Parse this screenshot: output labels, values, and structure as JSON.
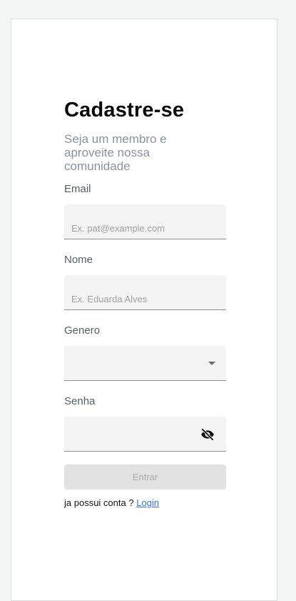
{
  "form": {
    "title": "Cadastre-se",
    "subtitle": "Seja um membro e aproveite nossa comunidade",
    "email": {
      "label": "Email",
      "placeholder": "Ex. pat@example.com",
      "value": ""
    },
    "nome": {
      "label": "Nome",
      "placeholder": "Ex. Eduarda Alves",
      "value": ""
    },
    "genero": {
      "label": "Genero",
      "selected": ""
    },
    "senha": {
      "label": "Senha",
      "value": ""
    },
    "submit_label": "Entrar",
    "footer_text": "ja possui conta ? ",
    "login_link": "Login"
  },
  "icons": {
    "dropdown": "chevron-down-icon",
    "password_visibility": "eye-off-icon"
  },
  "colors": {
    "link": "#3a6fd8",
    "subtitle": "#8793a3",
    "button_disabled_bg": "#e2e2e2"
  }
}
